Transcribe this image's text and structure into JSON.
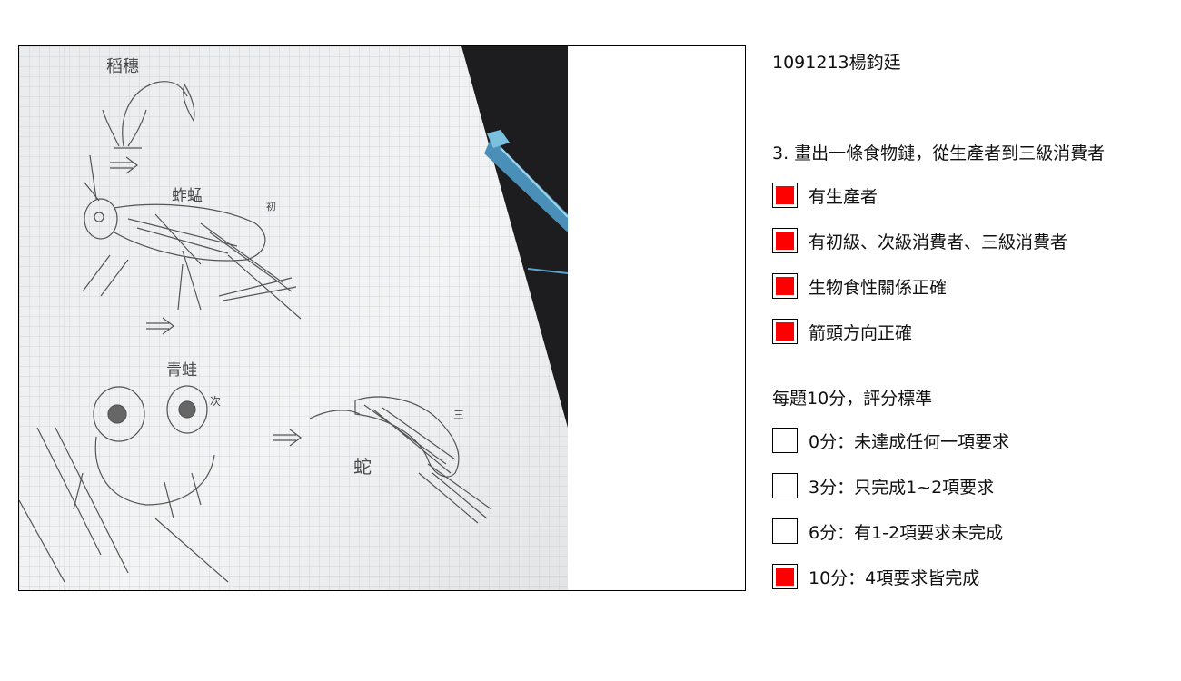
{
  "student_id": "1091213楊鈞廷",
  "question": "3. 畫出一條食物鏈，從生產者到三級消費者",
  "criteria": [
    {
      "label": "有生產者",
      "checked": true
    },
    {
      "label": "有初級、次級消費者、三級消費者",
      "checked": true
    },
    {
      "label": "生物食性關係正確",
      "checked": true
    },
    {
      "label": "箭頭方向正確",
      "checked": true
    }
  ],
  "grading_title": "每題10分，評分標準",
  "scores": [
    {
      "label": "0分：未達成任何一項要求",
      "checked": false
    },
    {
      "label": "3分：只完成1~2項要求",
      "checked": false
    },
    {
      "label": "6分：有1-2項要求未完成",
      "checked": false
    },
    {
      "label": "10分：4項要求皆完成",
      "checked": true
    }
  ],
  "drawing": {
    "labels": [
      "稻穗",
      "蚱蜢",
      "青蛙",
      "蛇"
    ],
    "trophic_marks": [
      "初",
      "次",
      "三"
    ]
  },
  "colors": {
    "check_fill": "#ff0000"
  }
}
